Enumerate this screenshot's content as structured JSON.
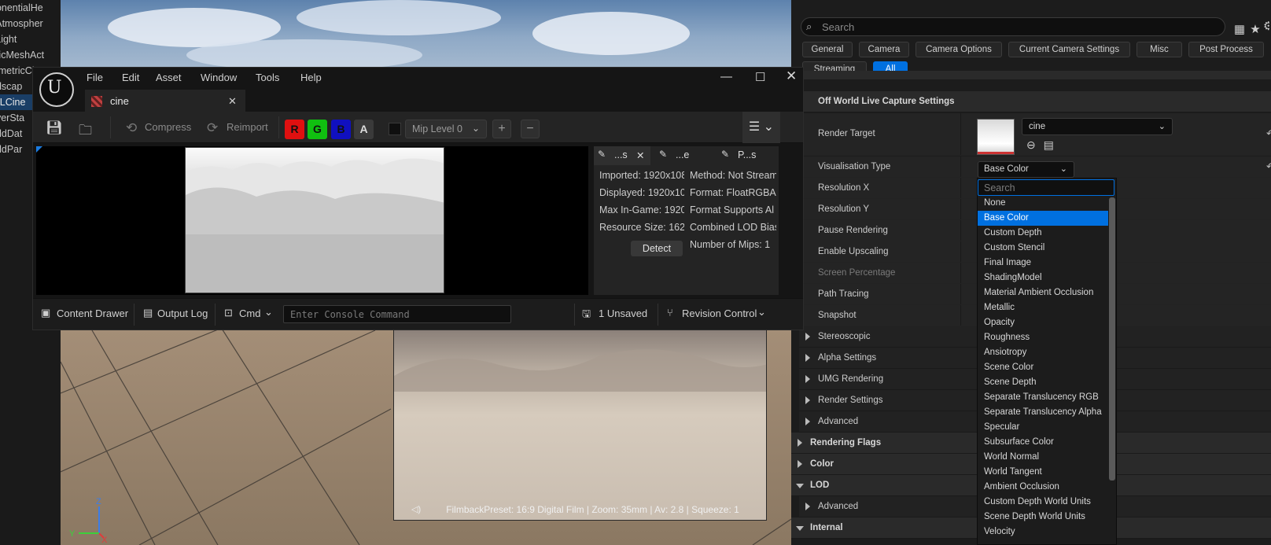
{
  "outliner": {
    "items": [
      "ponentialHe",
      "yAtmospher",
      "yLight",
      "aticMeshAct",
      "lumetricClou",
      "ndscap",
      "WLCine",
      "ayerSta",
      "orldDat",
      "orldPar"
    ],
    "selected_index": 6
  },
  "viewport": {
    "camera_caption": "FilmbackPreset: 16:9 Digital Film | Zoom: 35mm | Av: 2.8 | Squeeze: 1",
    "axis": {
      "z": "Z",
      "y": "Y",
      "x": "X"
    }
  },
  "texture_editor": {
    "menu": [
      "File",
      "Edit",
      "Asset",
      "Window",
      "Tools",
      "Help"
    ],
    "tab_title": "cine",
    "toolbar": {
      "compress_label": "Compress",
      "reimport_label": "Reimport",
      "channels": [
        "R",
        "G",
        "B",
        "A"
      ],
      "mip_level": "Mip Level 0"
    },
    "info_tabs": [
      "...s",
      "...e",
      "P...s"
    ],
    "info_left": [
      "Imported: 1920x108",
      "Displayed: 1920x10",
      "Max In-Game: 1920",
      "Resource Size: 162"
    ],
    "info_right": [
      "Method: Not Stream",
      "Format: FloatRGBA",
      "Format Supports Al",
      "Combined LOD Bias",
      "Number of Mips: 1"
    ],
    "detect_label": "Detect",
    "status": {
      "content_drawer": "Content Drawer",
      "output_log": "Output Log",
      "cmd": "Cmd",
      "console_placeholder": "Enter Console Command",
      "unsaved": "1 Unsaved",
      "revision_control": "Revision Control"
    }
  },
  "details": {
    "search_placeholder": "Search",
    "category_tabs": [
      "General",
      "Camera",
      "Camera Options",
      "Current Camera Settings",
      "Misc",
      "Post Process",
      "Streaming",
      "All"
    ],
    "active_tab": "All",
    "section_title": "Off World Live Capture Settings",
    "render_target_label": "Render Target",
    "render_target_value": "cine",
    "visualisation_label": "Visualisation Type",
    "visualisation_value": "Base Color",
    "properties": [
      "Resolution X",
      "Resolution Y",
      "Pause Rendering",
      "Enable Upscaling",
      "Screen Percentage",
      "Path Tracing",
      "Snapshot"
    ],
    "groups": [
      "Stereoscopic",
      "Alpha Settings",
      "UMG Rendering",
      "Render Settings",
      "Advanced"
    ],
    "categories": [
      "Rendering Flags",
      "Color",
      "LOD",
      "Advanced",
      "Internal"
    ]
  },
  "dropdown": {
    "search_placeholder": "Search",
    "options": [
      "None",
      "Base Color",
      "Custom Depth",
      "Custom Stencil",
      "Final Image",
      "ShadingModel",
      "Material Ambient Occlusion",
      "Metallic",
      "Opacity",
      "Roughness",
      "Ansiotropy",
      "Scene Color",
      "Scene Depth",
      "Separate Translucency RGB",
      "Separate Translucency Alpha",
      "Specular",
      "Subsurface Color",
      "World Normal",
      "World Tangent",
      "Ambient Occlusion",
      "Custom Depth World Units",
      "Scene Depth World Units",
      "Velocity"
    ],
    "selected": "Base Color"
  },
  "colors": {
    "accent": "#0070e0",
    "channel_r": "#e01010",
    "channel_g": "#10c010",
    "channel_b": "#1010c0"
  }
}
